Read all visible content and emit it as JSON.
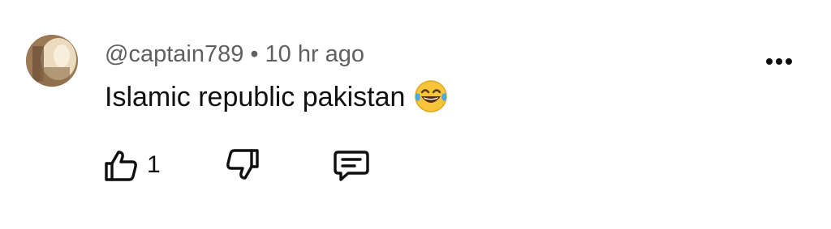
{
  "comment": {
    "author": "@captain789",
    "separator": "•",
    "timestamp": "10 hr ago",
    "text": "Islamic republic pakistan",
    "emoji": "face-with-tears-of-joy",
    "like_count": "1"
  },
  "icons": {
    "more": "more-options-icon",
    "like": "thumbs-up-icon",
    "dislike": "thumbs-down-icon",
    "reply": "reply-comment-icon"
  },
  "colors": {
    "meta_text": "#606060",
    "body_text": "#0f0f0f",
    "emoji_face": "#f7c53a",
    "emoji_tears": "#4aa8e8"
  }
}
